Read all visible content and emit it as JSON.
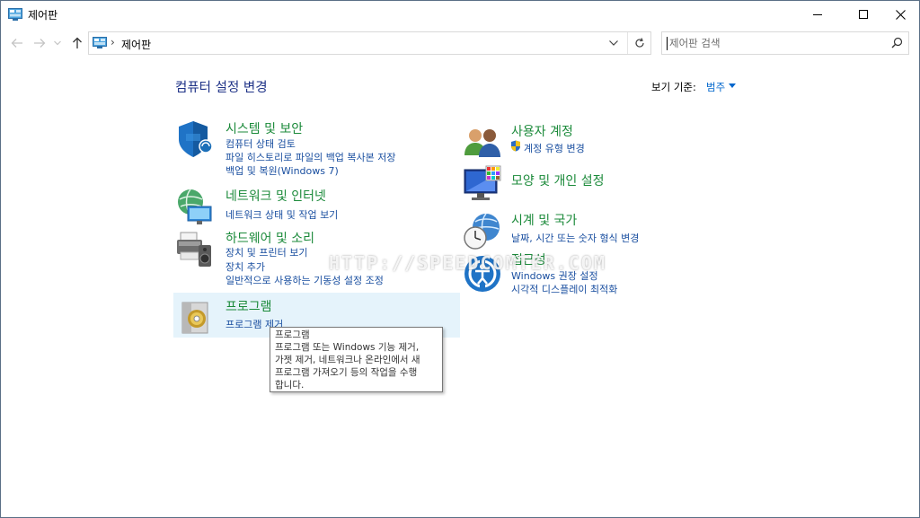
{
  "window": {
    "title": "제어판"
  },
  "titlebar": {
    "minimize_icon": "minimize-icon",
    "maximize_icon": "maximize-icon",
    "close_icon": "close-icon"
  },
  "address": {
    "crumb_sep": "›",
    "crumb": "제어판"
  },
  "search": {
    "placeholder": "제어판 검색"
  },
  "header": {
    "title": "컴퓨터 설정 변경",
    "view_by_label": "보기 기준:",
    "view_by_value": "범주"
  },
  "categories": {
    "system": {
      "title": "시스템 및 보안",
      "links": [
        "컴퓨터 상태 검토",
        "파일 히스토리로 파일의 백업 복사본 저장",
        "백업 및 복원(Windows 7)"
      ]
    },
    "network": {
      "title": "네트워크 및 인터넷",
      "links": [
        "네트워크 상태 및 작업 보기"
      ]
    },
    "hardware": {
      "title": "하드웨어 및 소리",
      "links": [
        "장치 및 프린터 보기",
        "장치 추가",
        "일반적으로 사용하는 기동성 설정 조정"
      ]
    },
    "programs": {
      "title": "프로그램",
      "links": [
        "프로그램 제거"
      ]
    },
    "users": {
      "title": "사용자 계정",
      "links": [
        "계정 유형 변경"
      ]
    },
    "appearance": {
      "title": "모양 및 개인 설정",
      "links": []
    },
    "clock": {
      "title": "시계 및 국가",
      "links": [
        "날짜, 시간 또는 숫자 형식 변경"
      ]
    },
    "access": {
      "title": "접근성",
      "links": [
        "Windows 권장 설정",
        "시각적 디스플레이 최적화"
      ]
    }
  },
  "tooltip": {
    "lines": [
      "프로그램",
      "프로그램 또는 Windows 기능 제거,",
      "가젯 제거, 네트워크나 온라인에서 새",
      "프로그램 가져오기 등의 작업을 수행",
      "합니다."
    ]
  },
  "watermark": "HTTP://SPEEDCOMTER.COM",
  "colors": {
    "accent_link": "#1a4fa0",
    "category_title": "#1b8a3a",
    "page_title": "#1e3287",
    "hover_bg": "#e5f3fb"
  }
}
